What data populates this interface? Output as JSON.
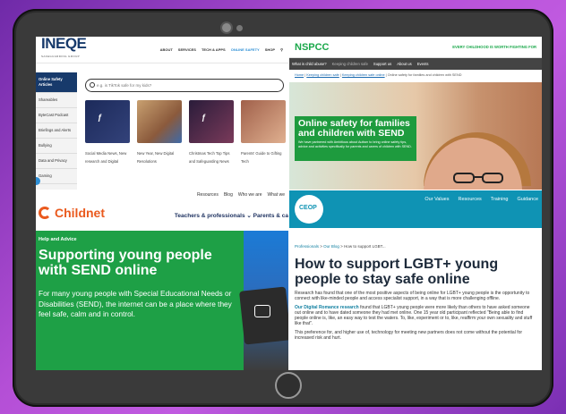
{
  "ineqe": {
    "logo": "INEQE",
    "logo_sub": "SAFEGUARDING GROUP",
    "nav": [
      "ABOUT",
      "SERVICES",
      "TECH & APPS",
      "ONLINE SAFETY",
      "SHOP"
    ],
    "sidebar": [
      "Online Safety Articles",
      "Shareables",
      "ByteCast Podcast",
      "Briefings and Alerts",
      "Bullying",
      "Data and Privacy",
      "Gaming"
    ],
    "search_placeholder": "e.g. is TikTok safe for my kids?",
    "cards": [
      "Social Media News, New research and Digital",
      "New Year, New Digital Resolutions",
      "Christmas Tech Top Tips and Safeguarding News",
      "Parents' Guide to Gifting Tech"
    ]
  },
  "nspcc": {
    "brand": "NSPCC",
    "tagline": "EVERY CHILDHOOD IS WORTH FIGHTING FOR",
    "menu": [
      "What is child abuse?",
      "Keeping children safe",
      "Support us",
      "About us",
      "Events"
    ],
    "crumbs": [
      "Home",
      "Keeping children safe",
      "Keeping children safe online",
      "Online safety for families and children with SEND"
    ],
    "hero_title": "Online safety for families and children with SEND",
    "hero_text": "We have partnered with Ambitious about Autism to bring online safety tips, advice and activities specifically for parents and carers of children with SEND."
  },
  "childnet": {
    "util_links": [
      "Resources",
      "Blog",
      "Who we are",
      "What we"
    ],
    "logo": "Childnet",
    "nav": "Teachers & professionals ⌄   Parents & ca",
    "kicker": "Help and Advice",
    "title": "Supporting young people with SEND online",
    "body": "For many young people with Special Educational Needs or Disabilities (SEND), the internet can be a place where they feel safe, calm and in control."
  },
  "ceop": {
    "badge": "CEOP",
    "links": [
      "Our Values",
      "Resources",
      "Training",
      "Guidance"
    ],
    "crumbs": [
      "Professionals",
      "Our Blog",
      "How to support LGBT..."
    ],
    "title": "How to support LGBT+ young people to stay safe online",
    "p1": "Research has found that one of the most positive aspects of being online for LGBT+ young people is the opportunity to connect with like-minded people and access specialist support, in a way that is more challenging offline.",
    "p2_link": "Our Digital Romance research",
    "p2": " found that LGBT+ young people were more likely than others to have asked someone out online and to have dated someone they had met online. One 15 year old participant reflected \"Being able to find people online is, like, an easy way to test the waters. To, like, experiment or to, like, reaffirm your own sexuality and stuff like that\".",
    "p3": "This preference for, and higher use of, technology for meeting new partners does not come without the potential for increased risk and hurt."
  }
}
